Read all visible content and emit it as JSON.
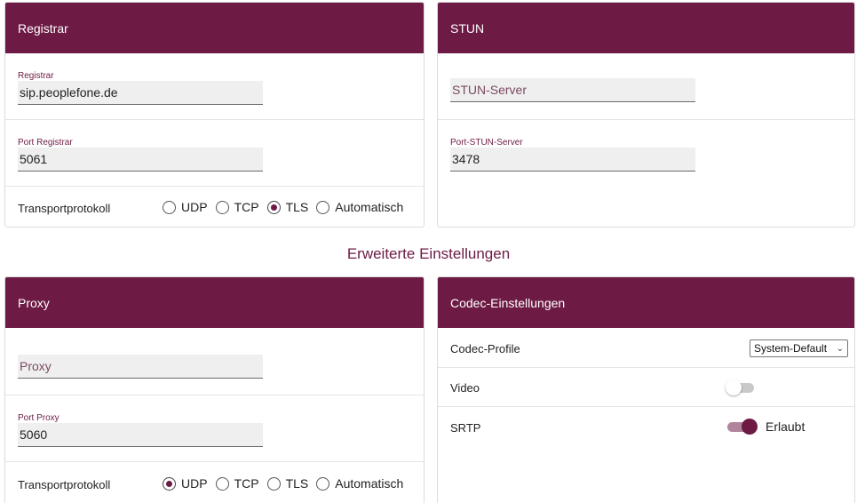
{
  "registrar_panel": {
    "header": "Registrar",
    "registrar": {
      "label": "Registrar",
      "value": "sip.peoplefone.de"
    },
    "port": {
      "label": "Port Registrar",
      "value": "5061"
    },
    "transport": {
      "label": "Transportprotokoll",
      "options": [
        "UDP",
        "TCP",
        "TLS",
        "Automatisch"
      ],
      "selected": "TLS"
    }
  },
  "stun_panel": {
    "header": "STUN",
    "server": {
      "placeholder": "STUN-Server",
      "value": ""
    },
    "port": {
      "label": "Port-STUN-Server",
      "value": "3478"
    }
  },
  "section_title": "Erweiterte Einstellungen",
  "proxy_panel": {
    "header": "Proxy",
    "proxy": {
      "placeholder": "Proxy",
      "value": ""
    },
    "port": {
      "label": "Port Proxy",
      "value": "5060"
    },
    "transport": {
      "label": "Transportprotokoll",
      "options": [
        "UDP",
        "TCP",
        "TLS",
        "Automatisch"
      ],
      "selected": "UDP"
    }
  },
  "codec_panel": {
    "header": "Codec-Einstellungen",
    "codec_profile": {
      "label": "Codec-Profile",
      "selected": "System-Default",
      "icon": "chevron-down-icon"
    },
    "video": {
      "label": "Video",
      "enabled": false
    },
    "srtp": {
      "label": "SRTP",
      "enabled": true,
      "state_text": "Erlaubt"
    }
  },
  "colors": {
    "header_bg": "#6d1a44",
    "accent": "#6d1a44",
    "field_bg": "#efefef"
  }
}
